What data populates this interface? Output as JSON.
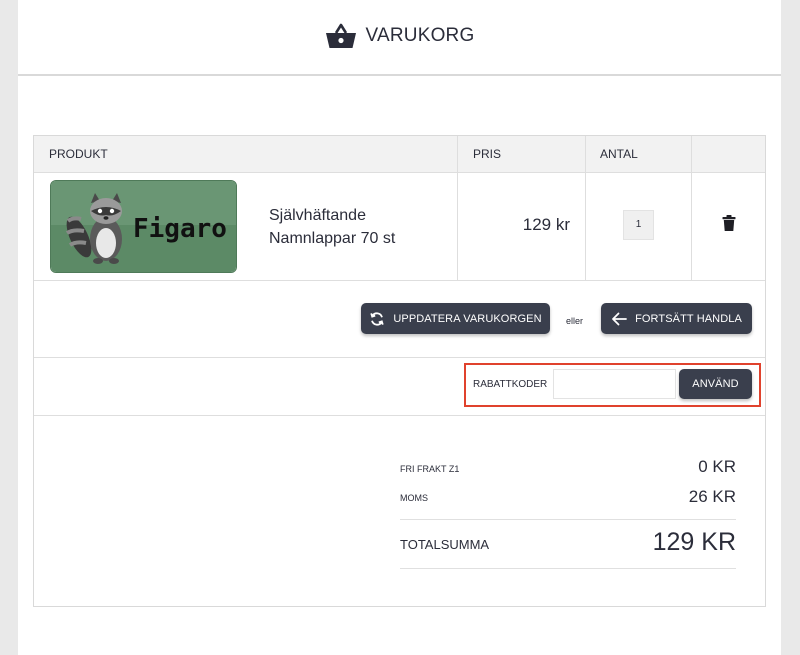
{
  "header": {
    "title": "VARUKORG",
    "icon": "basket-icon"
  },
  "table": {
    "columns": [
      "PRODUKT",
      "PRIS",
      "ANTAL",
      ""
    ],
    "rows": [
      {
        "image_text": "Figaro",
        "name_line1": "Självhäftande",
        "name_line2": "Namnlappar 70 st",
        "price": "129 kr",
        "quantity": "1",
        "remove_icon": "trash-icon"
      }
    ]
  },
  "actions": {
    "update_label": "UPPDATERA VARUKORGEN",
    "or_text": "eller",
    "continue_label": "FORTSÄTT HANDLA"
  },
  "discount": {
    "label": "RABATTKODER",
    "input_value": "",
    "apply_label": "ANVÄND"
  },
  "summary": {
    "shipping_label": "FRI FRAKT Z1",
    "shipping_value": "0 KR",
    "vat_label": "MOMS",
    "vat_value": "26 KR",
    "total_label": "TOTALSUMMA",
    "total_value": "129 KR"
  },
  "colors": {
    "button": "#3a3f4d",
    "highlight": "#e0422d",
    "product_bg": "#5c8a66"
  }
}
